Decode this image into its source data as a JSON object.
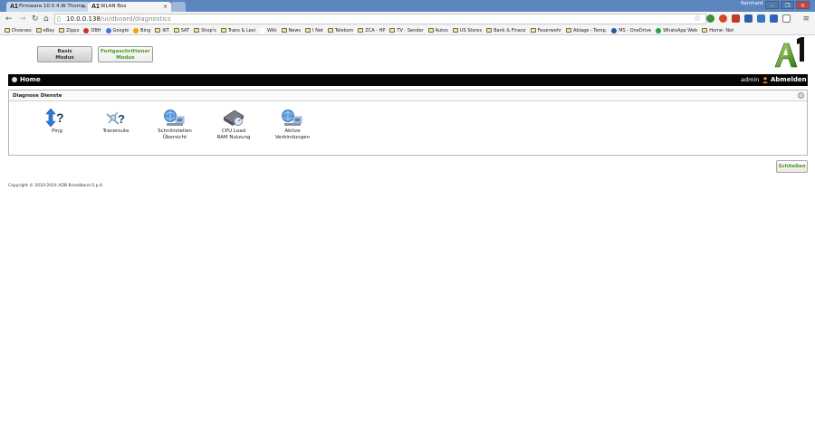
{
  "browser": {
    "tabs": [
      {
        "favicon": "A1",
        "label": "Firmware 10.5.4.W Thoms..."
      },
      {
        "favicon": "A1",
        "label": "WLAN Box"
      }
    ],
    "user": "Reinhard",
    "url_host": "10.0.0.138",
    "url_path": "/ui/dboard/diagnostics",
    "bookmarks": [
      "Diverses",
      "eBay",
      "Zippo",
      "OBH",
      "Google",
      "Bing",
      "IKT",
      "SAT",
      "Shop's",
      "Trans & Lexi",
      "Wiki",
      "News",
      "I Net",
      "Telekom",
      "ZCA - HP",
      "TV - Sender",
      "Autos",
      "US Stores",
      "Bank & Finanz",
      "Feuerwehr",
      "Ablage - Temp.",
      "MS - OneDrive",
      "WhatsApp Web",
      "Home- Net"
    ]
  },
  "modes": {
    "basis_line1": "Basis",
    "basis_line2": "Modus",
    "advanced_line1": "Fortgeschrittener",
    "advanced_line2": "Modus"
  },
  "logo_text": "A1",
  "homebar": {
    "home": "Home",
    "user": "admin",
    "logout": "Abmelden"
  },
  "panel": {
    "title": "Diagnose Dienste",
    "tools": [
      {
        "icon": "ping-icon",
        "line1": "Ping",
        "line2": ""
      },
      {
        "icon": "traceroute-icon",
        "line1": "Traceroute",
        "line2": ""
      },
      {
        "icon": "interfaces-icon",
        "line1": "Schnittstellen",
        "line2": "Übersicht"
      },
      {
        "icon": "cpu-ram-icon",
        "line1": "CPU Load",
        "line2": "RAM Nutzung"
      },
      {
        "icon": "connections-icon",
        "line1": "Aktive",
        "line2": "Verbindungen"
      }
    ]
  },
  "close_label": "Schließen",
  "copyright": "Copyright © 2010-2014 ADB Broadband S.p.A.",
  "colors": {
    "accent_green": "#4c9a1b",
    "homebar_bg": "#050505",
    "tabstrip_bg": "#5d86bf"
  }
}
